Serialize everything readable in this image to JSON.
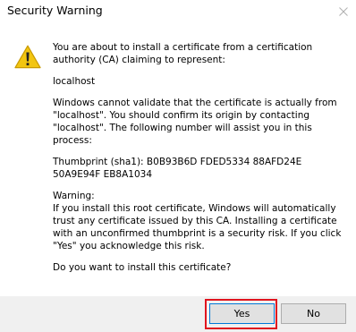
{
  "window": {
    "title": "Security Warning",
    "close_icon": "close-icon"
  },
  "icon": {
    "name": "warning-icon",
    "color": "#f2c511"
  },
  "message": {
    "intro": "You are about to install a certificate from a certification authority (CA) claiming to represent:",
    "host": "localhost",
    "validation": "Windows cannot validate that the certificate is actually from \"localhost\". You should confirm its origin by contacting \"localhost\". The following number will assist you in this process:",
    "thumbprint": "Thumbprint (sha1): B0B93B6D FDED5334 88AFD24E 50A9E94F EB8A1034",
    "warning_heading": "Warning:",
    "warning_body": "If you install this root certificate, Windows will automatically trust any certificate issued by this CA. Installing a certificate with an unconfirmed thumbprint is a security risk. If you click \"Yes\" you acknowledge this risk.",
    "question": "Do you want to install this certificate?"
  },
  "buttons": {
    "yes_label": "Yes",
    "no_label": "No"
  },
  "colors": {
    "highlight": "#e0141e",
    "footer_bg": "#f0f0f0",
    "focus_border": "#0078d7"
  }
}
